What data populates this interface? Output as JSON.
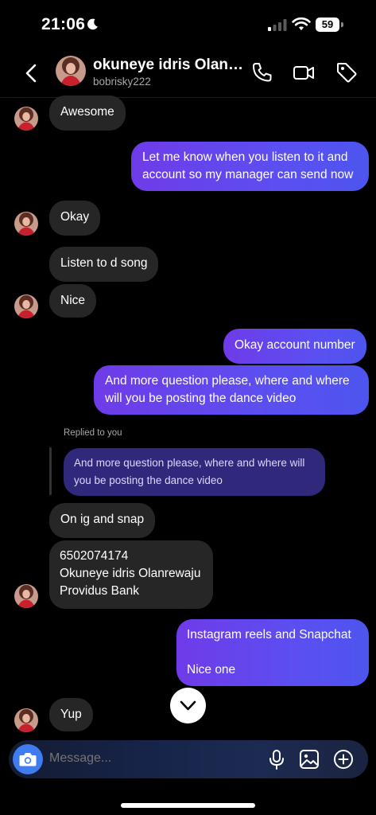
{
  "status_bar": {
    "time": "21:06",
    "battery": "59"
  },
  "header": {
    "name": "okuneye idris Olanr...",
    "username": "bobrisky222"
  },
  "messages": [
    {
      "text": "Awesome"
    },
    {
      "text": "Let me know when you listen to it and\naccount so my manager can send now"
    },
    {
      "text": "Okay"
    },
    {
      "text": "Listen to d song"
    },
    {
      "text": "Nice"
    },
    {
      "text": "Okay account number"
    },
    {
      "text": "And more question please, where and where\nwill you be posting the dance video"
    },
    {
      "text": "On ig and snap"
    },
    {
      "text": "6502074174\nOkuneye idris Olanrewaju\nProvidus Bank"
    },
    {
      "text": "Instagram reels and Snapchat\n\nNice one"
    },
    {
      "text": "Yup"
    }
  ],
  "reply": {
    "label": "Replied to you",
    "quote": "And more question please, where and where will you be posting the dance video"
  },
  "composer": {
    "placeholder": "Message..."
  },
  "colors": {
    "outgoing_gradient_start": "#6f3be8",
    "outgoing_gradient_end": "#4e55ef",
    "incoming_bubble": "#262626",
    "camera_button": "#3f7cf0"
  },
  "icons": [
    "back-arrow-icon",
    "phone-icon",
    "video-camera-icon",
    "tag-icon",
    "camera-icon",
    "microphone-icon",
    "gallery-icon",
    "plus-circle-icon",
    "chevron-down-icon"
  ]
}
